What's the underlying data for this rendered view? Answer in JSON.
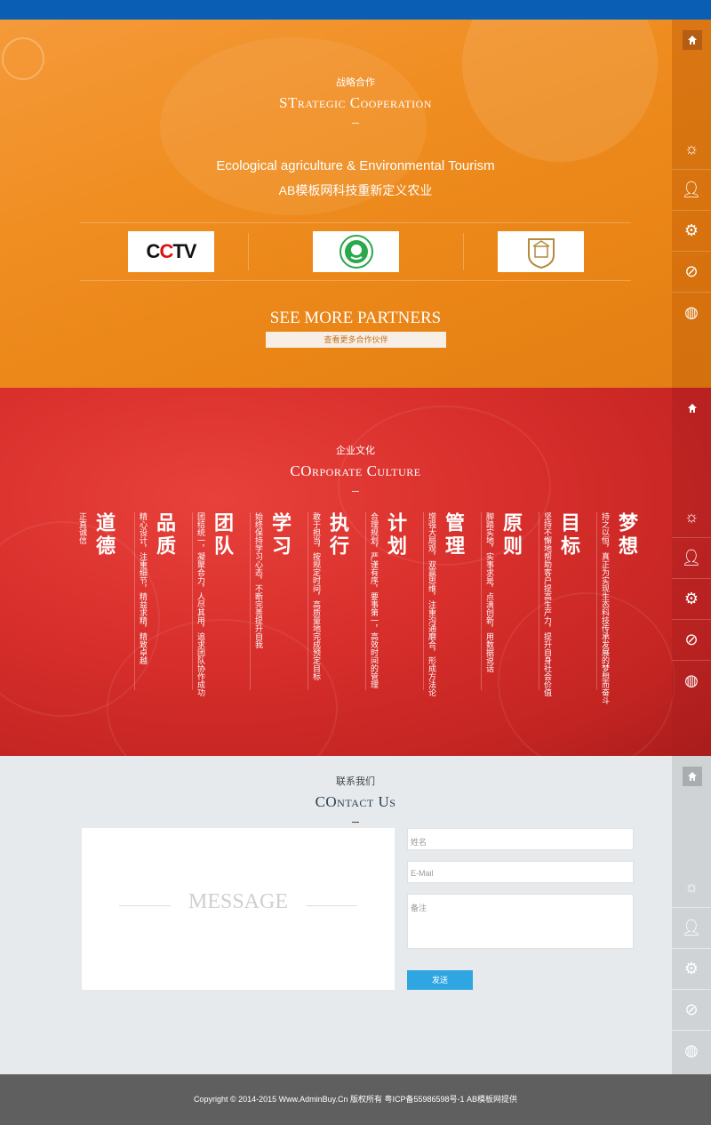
{
  "coop": {
    "title_cn": "战略合作",
    "title_en": "STrategic Cooperation",
    "subtitle_en": "Ecological agriculture & Environmental Tourism",
    "subtitle_cn": "AB模板网科技重新定义农业",
    "partners": [
      {
        "name": "CCTV"
      },
      {
        "name": "中国生态农业"
      },
      {
        "name": "大学校徽"
      }
    ],
    "see_more": "SEE MORE PARTNERS",
    "see_more_btn": "查看更多合作伙伴"
  },
  "culture": {
    "title_cn": "企业文化",
    "title_en": "COrporate Culture",
    "columns": [
      {
        "heading": "道德",
        "text": "正直诚信"
      },
      {
        "heading": "品质",
        "text": "精心设计，注重细节，精益求精，精致卓越"
      },
      {
        "heading": "团队",
        "text": "团结统一，凝聚合力，人尽其用，追求团队协作成功"
      },
      {
        "heading": "学习",
        "text": "始终保持学习心态，不断完善提升自我"
      },
      {
        "heading": "执行",
        "text": "敢于担当，按规定时间，高质量地完成预定目标"
      },
      {
        "heading": "计划",
        "text": "合理规划，严谨有序，要事第一，高效时间的管理"
      },
      {
        "heading": "管理",
        "text": "增强大局观，双赢思维，注重沟通磨合，形成方法论"
      },
      {
        "heading": "原则",
        "text": "脚踏实地，实事求是，点滴创新，用数据说话"
      },
      {
        "heading": "目标",
        "text": "坚持不懈地帮助客户提高生产力，提升自身社会价值"
      },
      {
        "heading": "梦想",
        "text": "持之以恒，真正为实现生态科技传承发展的梦想而奋斗"
      }
    ]
  },
  "contact": {
    "title_cn": "联系我们",
    "title_en": "COntact Us",
    "message_label": "MESSAGE",
    "name_placeholder": "姓名",
    "email_placeholder": "E-Mail",
    "note_placeholder": "备注",
    "send_label": "发送"
  },
  "footer": {
    "copyright": "Copyright © 2014-2015 Www.AdminBuy.Cn 版权所有 粤ICP备55986598号-1      AB模板网提供"
  },
  "side_nav": {
    "icons": [
      "home-icon",
      "sun-icon",
      "user-icon",
      "gears-icon",
      "leaf-icon",
      "globe-icon"
    ]
  },
  "colors": {
    "topbar": "#0a5fb4",
    "orange": "#f08e22",
    "red": "#d72e2b",
    "contact_bg": "#e6eaec",
    "send": "#2fa6e2",
    "footer": "#5f5f5f"
  }
}
